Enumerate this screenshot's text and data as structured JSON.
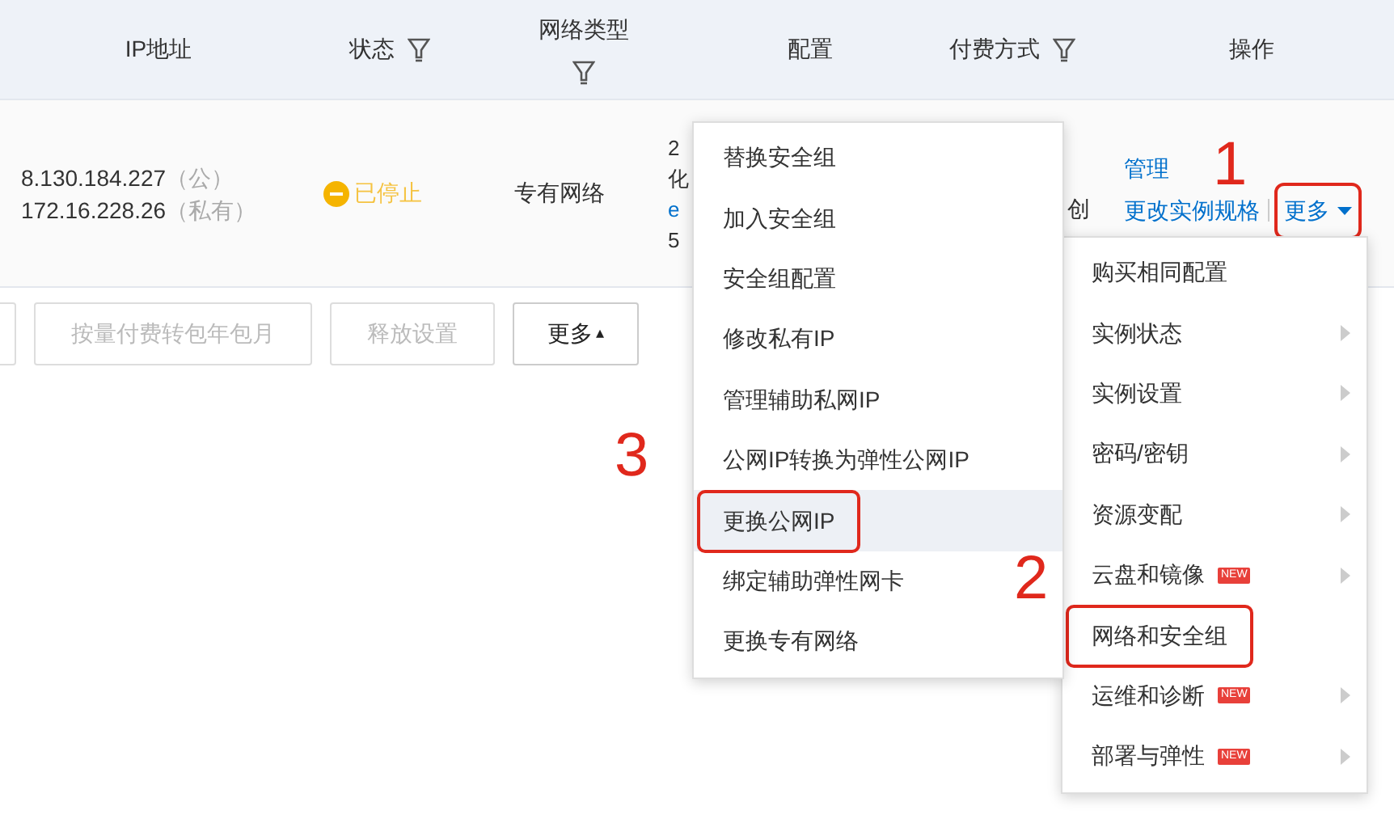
{
  "table": {
    "columns": [
      {
        "label": "IP地址",
        "filter": false
      },
      {
        "label": "状态",
        "filter": true
      },
      {
        "label": "网络类型",
        "filter": true
      },
      {
        "label": "配置",
        "filter": false
      },
      {
        "label": "付费方式",
        "filter": true
      },
      {
        "label": "操作",
        "filter": false
      }
    ],
    "row": {
      "ip_public": "8.130.184.227",
      "ip_public_tag": "（公）",
      "ip_private": "172.16.228.26",
      "ip_private_tag": "（私有）",
      "status": "已停止",
      "network": "专有网络",
      "config_lines": [
        {
          "text": "2",
          "kind": "plain"
        },
        {
          "text": "化",
          "kind": "plain"
        },
        {
          "text": "e",
          "kind": "link"
        },
        {
          "text": "5",
          "kind": "plain"
        }
      ],
      "payment": "创",
      "actions": [
        {
          "label": "管理",
          "kind": "link"
        },
        {
          "label": "更改实例规格",
          "kind": "link"
        },
        {
          "label": "更多",
          "kind": "dropdown",
          "marked": true
        }
      ]
    }
  },
  "toolbar": {
    "buttons": [
      {
        "label": "按量付费转包年包月",
        "disabled": true
      },
      {
        "label": "释放设置",
        "disabled": true
      },
      {
        "label": "更多",
        "disabled": false,
        "caret": "▴"
      }
    ]
  },
  "more_menu": {
    "items": [
      {
        "label": "购买相同配置",
        "submenu": false,
        "marked": false
      },
      {
        "label": "实例状态",
        "submenu": true,
        "marked": false
      },
      {
        "label": "实例设置",
        "submenu": true,
        "marked": false
      },
      {
        "label": "密码/密钥",
        "submenu": true,
        "marked": false
      },
      {
        "label": "资源变配",
        "submenu": true,
        "marked": false
      },
      {
        "label": "云盘和镜像",
        "badge": "NEW",
        "submenu": true,
        "marked": false
      },
      {
        "label": "网络和安全组",
        "submenu": false,
        "marked": true
      },
      {
        "label": "运维和诊断",
        "badge": "NEW",
        "submenu": true,
        "marked": false
      },
      {
        "label": "部署与弹性",
        "badge": "NEW",
        "submenu": true,
        "marked": false
      }
    ]
  },
  "network_submenu": {
    "items": [
      {
        "label": "替换安全组",
        "selected": false,
        "marked": false
      },
      {
        "label": "加入安全组",
        "selected": false,
        "marked": false
      },
      {
        "label": "安全组配置",
        "selected": false,
        "marked": false
      },
      {
        "label": "修改私有IP",
        "selected": false,
        "marked": false
      },
      {
        "label": "管理辅助私网IP",
        "selected": false,
        "marked": false
      },
      {
        "label": "公网IP转换为弹性公网IP",
        "selected": false,
        "marked": false
      },
      {
        "label": "更换公网IP",
        "selected": true,
        "marked": true
      },
      {
        "label": "绑定辅助弹性网卡",
        "selected": false,
        "marked": false
      },
      {
        "label": "更换专有网络",
        "selected": false,
        "marked": false
      }
    ]
  },
  "annotations": [
    {
      "text": "1"
    },
    {
      "text": "2"
    },
    {
      "text": "3"
    }
  ]
}
